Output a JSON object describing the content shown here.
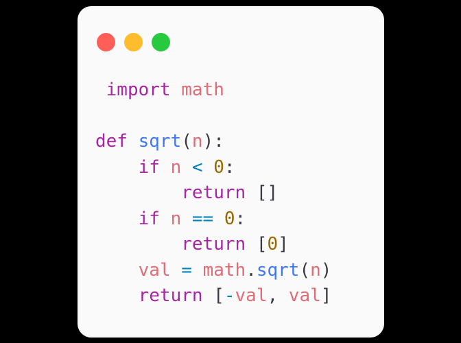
{
  "page": {
    "background_color": "#000000"
  },
  "window": {
    "background_color": "#FAFAFA",
    "titlebar": {
      "buttons": [
        {
          "name": "close",
          "color": "#FF5F56"
        },
        {
          "name": "minimize",
          "color": "#FFBD2E"
        },
        {
          "name": "zoom",
          "color": "#27C93F"
        }
      ]
    }
  },
  "theme": {
    "keyword": "#A626A4",
    "name": "#E06C75",
    "function": "#4078F2",
    "operator": "#0184BC",
    "number": "#986801",
    "punctuation": "#383A42"
  },
  "code": {
    "language": "python",
    "lines": [
      {
        "index": 0,
        "text": " import math",
        "tokens": [
          {
            "t": " ",
            "c": "plain"
          },
          {
            "t": "import",
            "c": "keyword"
          },
          {
            "t": " ",
            "c": "plain"
          },
          {
            "t": "math",
            "c": "name"
          }
        ]
      },
      {
        "index": 1,
        "text": "",
        "tokens": []
      },
      {
        "index": 2,
        "text": "def sqrt(n):",
        "tokens": [
          {
            "t": "def",
            "c": "keyword"
          },
          {
            "t": " ",
            "c": "plain"
          },
          {
            "t": "sqrt",
            "c": "function"
          },
          {
            "t": "(",
            "c": "punct"
          },
          {
            "t": "n",
            "c": "name"
          },
          {
            "t": ")",
            "c": "punct"
          },
          {
            "t": ":",
            "c": "punct"
          }
        ]
      },
      {
        "index": 3,
        "text": "    if n < 0:",
        "tokens": [
          {
            "t": "    ",
            "c": "plain"
          },
          {
            "t": "if",
            "c": "keyword"
          },
          {
            "t": " ",
            "c": "plain"
          },
          {
            "t": "n",
            "c": "name"
          },
          {
            "t": " ",
            "c": "plain"
          },
          {
            "t": "<",
            "c": "operator"
          },
          {
            "t": " ",
            "c": "plain"
          },
          {
            "t": "0",
            "c": "number"
          },
          {
            "t": ":",
            "c": "punct"
          }
        ]
      },
      {
        "index": 4,
        "text": "        return []",
        "tokens": [
          {
            "t": "        ",
            "c": "plain"
          },
          {
            "t": "return",
            "c": "keyword"
          },
          {
            "t": " ",
            "c": "plain"
          },
          {
            "t": "[",
            "c": "punct"
          },
          {
            "t": "]",
            "c": "punct"
          }
        ]
      },
      {
        "index": 5,
        "text": "    if n == 0:",
        "tokens": [
          {
            "t": "    ",
            "c": "plain"
          },
          {
            "t": "if",
            "c": "keyword"
          },
          {
            "t": " ",
            "c": "plain"
          },
          {
            "t": "n",
            "c": "name"
          },
          {
            "t": " ",
            "c": "plain"
          },
          {
            "t": "==",
            "c": "operator"
          },
          {
            "t": " ",
            "c": "plain"
          },
          {
            "t": "0",
            "c": "number"
          },
          {
            "t": ":",
            "c": "punct"
          }
        ]
      },
      {
        "index": 6,
        "text": "        return [0]",
        "tokens": [
          {
            "t": "        ",
            "c": "plain"
          },
          {
            "t": "return",
            "c": "keyword"
          },
          {
            "t": " ",
            "c": "plain"
          },
          {
            "t": "[",
            "c": "punct"
          },
          {
            "t": "0",
            "c": "number"
          },
          {
            "t": "]",
            "c": "punct"
          }
        ]
      },
      {
        "index": 7,
        "text": "    val = math.sqrt(n)",
        "tokens": [
          {
            "t": "    ",
            "c": "plain"
          },
          {
            "t": "val",
            "c": "name"
          },
          {
            "t": " ",
            "c": "plain"
          },
          {
            "t": "=",
            "c": "operator"
          },
          {
            "t": " ",
            "c": "plain"
          },
          {
            "t": "math",
            "c": "name"
          },
          {
            "t": ".",
            "c": "punct"
          },
          {
            "t": "sqrt",
            "c": "function"
          },
          {
            "t": "(",
            "c": "punct"
          },
          {
            "t": "n",
            "c": "name"
          },
          {
            "t": ")",
            "c": "punct"
          }
        ]
      },
      {
        "index": 8,
        "text": "    return [-val, val]",
        "tokens": [
          {
            "t": "    ",
            "c": "plain"
          },
          {
            "t": "return",
            "c": "keyword"
          },
          {
            "t": " ",
            "c": "plain"
          },
          {
            "t": "[",
            "c": "punct"
          },
          {
            "t": "-",
            "c": "operator"
          },
          {
            "t": "val",
            "c": "name"
          },
          {
            "t": ",",
            "c": "punct"
          },
          {
            "t": " ",
            "c": "plain"
          },
          {
            "t": "val",
            "c": "name"
          },
          {
            "t": "]",
            "c": "punct"
          }
        ]
      }
    ]
  }
}
